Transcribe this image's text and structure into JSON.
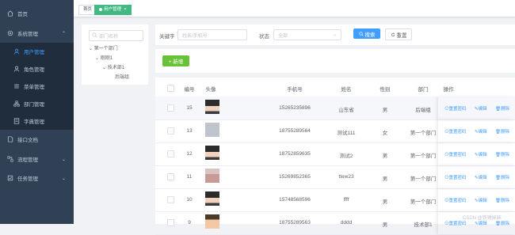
{
  "sidebar": {
    "items": [
      {
        "label": "首页",
        "icon": "home-icon",
        "sub": false,
        "active": false,
        "chevron": ""
      },
      {
        "label": "系统管理",
        "icon": "system-icon",
        "sub": false,
        "active": false,
        "chevron": "⌃"
      },
      {
        "label": "用户管理",
        "icon": "user-icon",
        "sub": true,
        "active": true,
        "chevron": ""
      },
      {
        "label": "角色管理",
        "icon": "role-icon",
        "sub": true,
        "active": false,
        "chevron": ""
      },
      {
        "label": "菜单管理",
        "icon": "menu-icon",
        "sub": true,
        "active": false,
        "chevron": ""
      },
      {
        "label": "部门管理",
        "icon": "dept-icon",
        "sub": true,
        "active": false,
        "chevron": ""
      },
      {
        "label": "字典管理",
        "icon": "dict-icon",
        "sub": true,
        "active": false,
        "chevron": ""
      },
      {
        "label": "接口文档",
        "icon": "doc-icon",
        "sub": false,
        "active": false,
        "chevron": ""
      },
      {
        "label": "流程管理",
        "icon": "flow-icon",
        "sub": false,
        "active": false,
        "chevron": "⌄"
      },
      {
        "label": "任务管理",
        "icon": "task-icon",
        "sub": false,
        "active": false,
        "chevron": "⌄"
      }
    ]
  },
  "tags": {
    "home": "首页",
    "current": "用户管理",
    "close": "×"
  },
  "tree": {
    "search_placeholder": "部门名称",
    "nodes": [
      {
        "label": "第一个部门",
        "toggle": "⌄"
      },
      {
        "label": "刚刚1",
        "toggle": "⌄"
      },
      {
        "label": "技术部1",
        "toggle": "⌄"
      },
      {
        "label": "后端组",
        "toggle": ""
      }
    ]
  },
  "search": {
    "keyword_label": "关键字",
    "keyword_placeholder": "姓名/手机号",
    "status_label": "状态",
    "status_value": "全部",
    "search_button": "搜索",
    "reset_button": "重置"
  },
  "toolbar": {
    "add_button": "+ 新增"
  },
  "table": {
    "columns": [
      "编号",
      "头像",
      "手机号",
      "姓名",
      "性别",
      "部门",
      "操作"
    ],
    "actions": {
      "reset": "重置密码",
      "edit": "编辑",
      "delete": "删除"
    },
    "rows": [
      {
        "id": "15",
        "avatar": "avatar-anime",
        "phone": "15265235896",
        "name": "山东省",
        "gender": "男",
        "dept": "后端组"
      },
      {
        "id": "13",
        "avatar": "avatar-placeholder",
        "phone": "18755289564",
        "name": "测试111",
        "gender": "女",
        "dept": "第一个部门"
      },
      {
        "id": "12",
        "avatar": "avatar-anime",
        "phone": "18752859635",
        "name": "测试2",
        "gender": "男",
        "dept": "第一个部门"
      },
      {
        "id": "11",
        "avatar": "avatar-photo",
        "phone": "15269852365",
        "name": "ttew23",
        "gender": "男",
        "dept": "第一个部门"
      },
      {
        "id": "10",
        "avatar": "avatar-anime",
        "phone": "15748568596",
        "name": "ffff",
        "gender": "男",
        "dept": "第一个部门"
      },
      {
        "id": "9",
        "avatar": "avatar-cartoon",
        "phone": "18755289563",
        "name": "dddd",
        "gender": "男",
        "dept": "技术部1"
      }
    ]
  },
  "watermark": "CSDN @铁锤妹妹",
  "colors": {
    "sidebar": "#304156",
    "primary": "#409eff",
    "success": "#67c23a",
    "tag": "#42b983"
  }
}
